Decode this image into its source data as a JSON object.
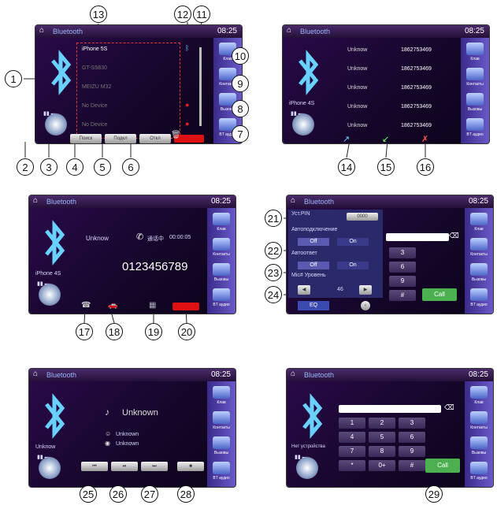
{
  "common": {
    "title": "Bluetooth",
    "time": "08:25"
  },
  "sidebar_labels": [
    "Клав",
    "Контакты",
    "Вызовы",
    "BT аудио"
  ],
  "callouts": [
    "1",
    "2",
    "3",
    "4",
    "5",
    "6",
    "7",
    "8",
    "9",
    "10",
    "11",
    "12",
    "13",
    "14",
    "15",
    "16",
    "17",
    "18",
    "19",
    "20",
    "21",
    "22",
    "23",
    "24",
    "25",
    "26",
    "27",
    "28",
    "29"
  ],
  "panel1": {
    "devices": [
      "iPhone 5S",
      "GT-S5830",
      "MEIZU M32",
      "No Device",
      "No Device"
    ],
    "buttons": [
      "Поиск",
      "Подкл",
      "Откл"
    ]
  },
  "panel2": {
    "side_name": "iPhone 4S",
    "calls": [
      {
        "name": "Unknow",
        "number": "1862753469"
      },
      {
        "name": "Unknow",
        "number": "1862753469"
      },
      {
        "name": "Unknow",
        "number": "1862753469"
      },
      {
        "name": "Unknow",
        "number": "1862753469"
      },
      {
        "name": "Unknow",
        "number": "1862753469"
      }
    ]
  },
  "panel3": {
    "side_name": "iPhone 4S",
    "caller": "Unknow",
    "status": "通话中",
    "duration": "00:00:05",
    "number": "0123456789"
  },
  "panel4": {
    "pin_label": "Уст.PIN",
    "pin_value": "0000",
    "auto_connect_label": "Автоподключение",
    "auto_answer_label": "Автоответ",
    "mic_label": "Mic# Уровень",
    "off": "Off",
    "on": "On",
    "level": "46",
    "eq": "EQ",
    "keys": [
      "3",
      "6",
      "9",
      "#"
    ],
    "call": "Call"
  },
  "panel5": {
    "side_name": "Unknow",
    "title": "Unknown",
    "artist": "Unknown",
    "album": "Unknown"
  },
  "panel6": {
    "side_name": "Нет устройства",
    "keys": [
      "1",
      "2",
      "3",
      "4",
      "5",
      "6",
      "7",
      "8",
      "9",
      "*",
      "0+",
      "#"
    ],
    "call": "Call"
  }
}
